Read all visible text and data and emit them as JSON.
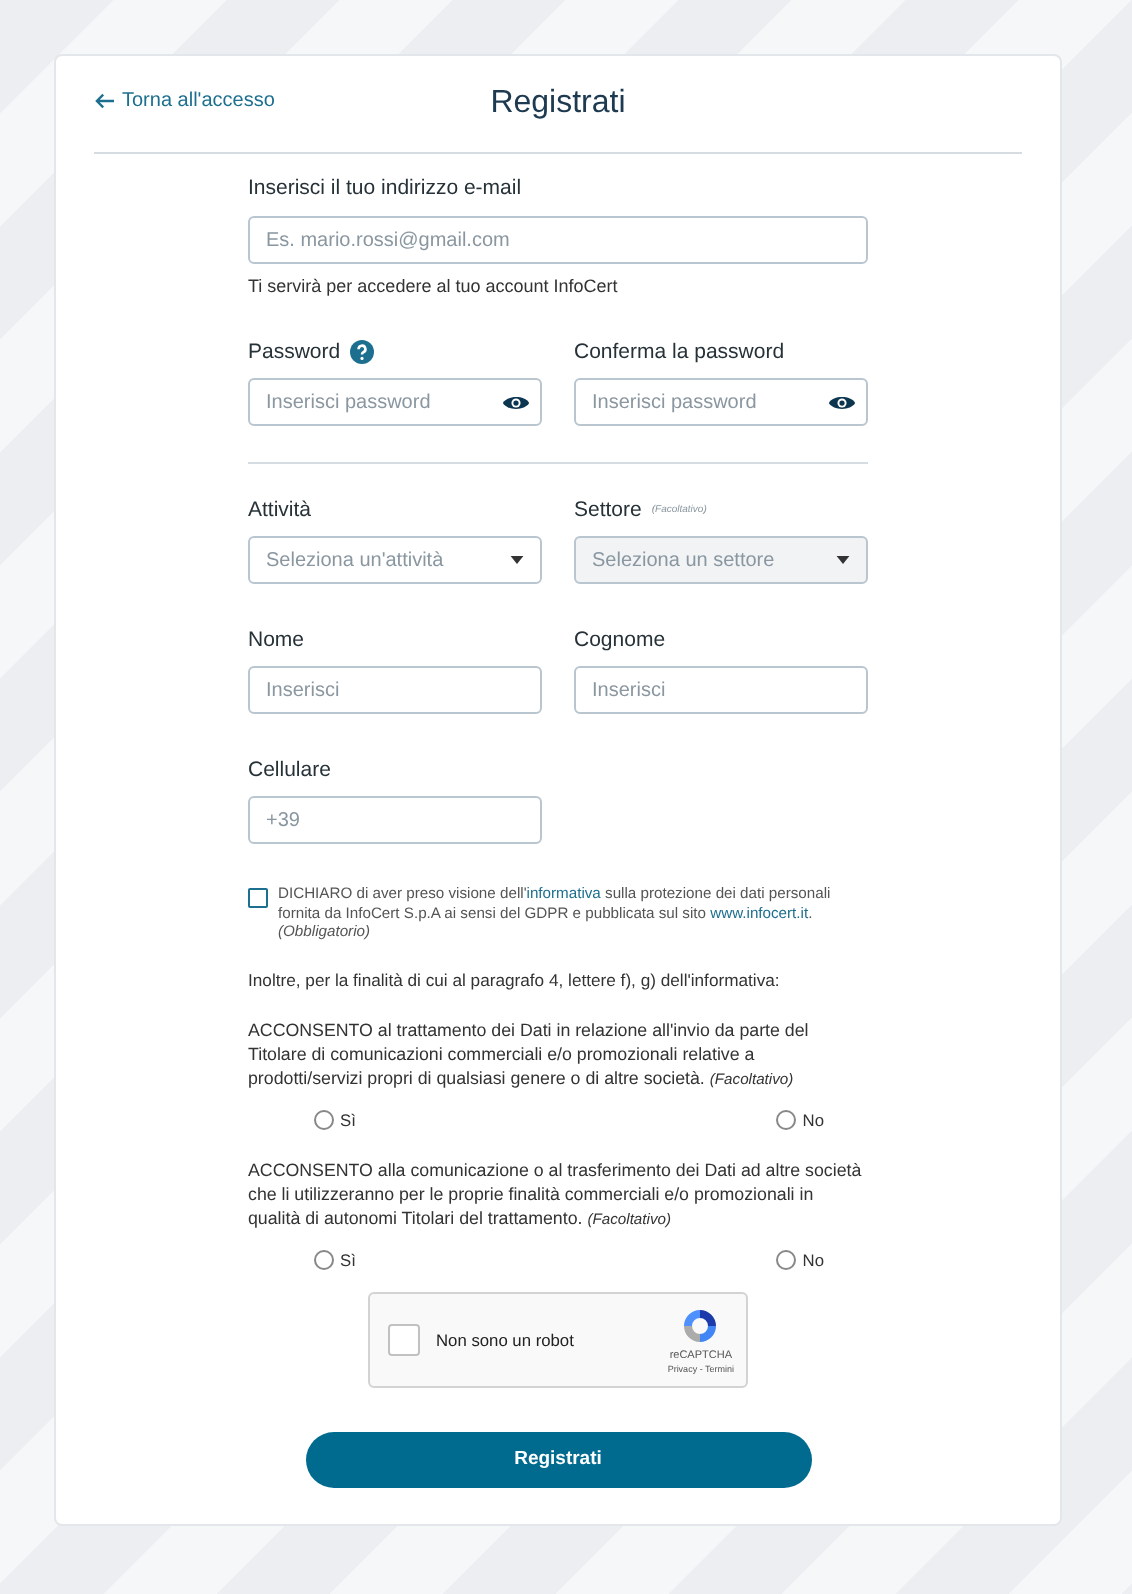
{
  "back_link": {
    "label": "Torna all'accesso"
  },
  "title": "Registrati",
  "email": {
    "label": "Inserisci il tuo indirizzo e-mail",
    "placeholder": "Es. mario.rossi@gmail.com",
    "hint": "Ti servirà per accedere al tuo account InfoCert"
  },
  "password_row": [
    {
      "kind": "password",
      "label": "Password",
      "help": true,
      "placeholder": "Inserisci password"
    },
    {
      "kind": "password",
      "label": "Conferma la password",
      "help": false,
      "placeholder": "Inserisci password"
    }
  ],
  "field_rows": [
    [
      {
        "kind": "select",
        "label": "Attività",
        "placeholder": "Seleziona un'attività",
        "disabled": false
      },
      {
        "kind": "select",
        "label": "Settore",
        "note": "(Facoltativo)",
        "placeholder": "Seleziona un settore",
        "disabled": true
      }
    ],
    [
      {
        "kind": "text",
        "label": "Nome",
        "placeholder": "Inserisci"
      },
      {
        "kind": "text",
        "label": "Cognome",
        "placeholder": "Inserisci"
      }
    ],
    [
      {
        "kind": "text",
        "label": "Cellulare",
        "placeholder": "+39"
      }
    ]
  ],
  "declaration": {
    "checked": false,
    "parts": [
      {
        "kind": "text",
        "text": "DICHIARO di aver preso visione dell'"
      },
      {
        "kind": "link",
        "text": "informativa"
      },
      {
        "kind": "text",
        "text": " sulla protezione dei dati personali fornita da InfoCert S.p.A ai sensi del GDPR e pubblicata sul sito "
      },
      {
        "kind": "link",
        "text": "www.infocert.it"
      },
      {
        "kind": "text",
        "text": ". "
      },
      {
        "kind": "note",
        "text": "(Obbligatorio)"
      }
    ]
  },
  "intro": "Inoltre, per la finalità di cui al paragrafo 4, lettere f), g) dell'informativa:",
  "consents": [
    {
      "text": "ACCONSENTO al trattamento dei Dati in relazione all'invio da parte del Titolare di comunicazioni commerciali e/o promozionali relative a prodotti/servizi propri di qualsiasi genere o di altre società.",
      "note": "(Facoltativo)",
      "options": [
        {
          "label": "Sì",
          "selected": false
        },
        {
          "label": "No",
          "selected": false
        }
      ]
    },
    {
      "text": "ACCONSENTO alla comunicazione o al trasferimento dei Dati ad altre società che li utilizzeranno per le proprie finalità commerciali e/o promozionali in qualità di autonomi Titolari del trattamento.",
      "note": "(Facoltativo)",
      "options": [
        {
          "label": "Sì",
          "selected": false
        },
        {
          "label": "No",
          "selected": false
        }
      ]
    }
  ],
  "captcha": {
    "checked": false,
    "label": "Non sono un robot",
    "brand": "reCAPTCHA",
    "links": "Privacy - Termini"
  },
  "submit": "Registrati"
}
